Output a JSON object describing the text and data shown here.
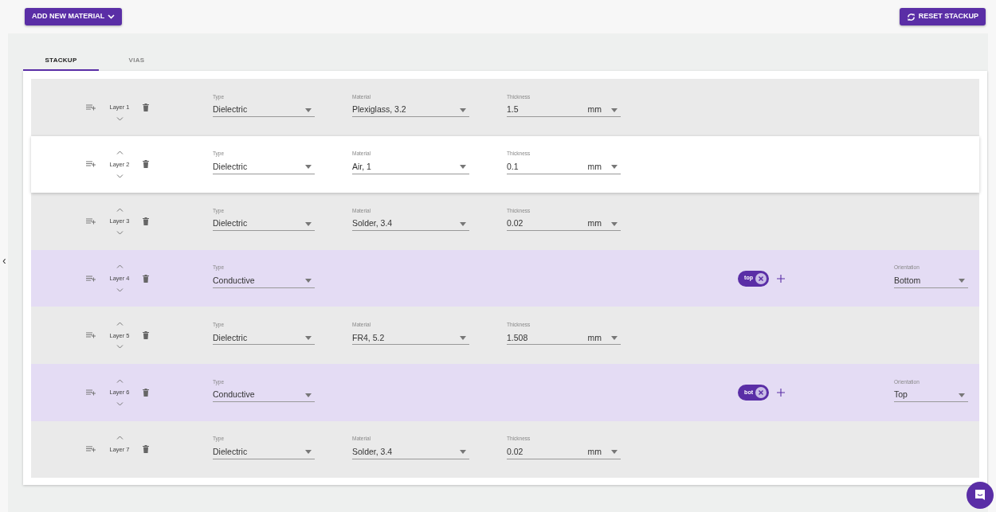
{
  "toolbar": {
    "add_button": "ADD NEW MATERIAL",
    "reset_button": "RESET STACKUP"
  },
  "side_toggle": "‹",
  "tabs": [
    {
      "label": "STACKUP",
      "selected": true
    },
    {
      "label": "VIAS",
      "selected": false
    }
  ],
  "layers": [
    {
      "kind": "dielectric",
      "hovered": false,
      "name": "Layer 1",
      "can_move_up": false,
      "can_move_down": true,
      "type": {
        "label": "Type",
        "value": "Dielectric"
      },
      "material": {
        "label": "Material",
        "value": "Plexiglass, 3.2"
      },
      "thickness": {
        "label": "Thickness",
        "value": "1.5",
        "unit": "mm"
      }
    },
    {
      "kind": "dielectric",
      "hovered": true,
      "name": "Layer 2",
      "can_move_up": true,
      "can_move_down": true,
      "type": {
        "label": "Type",
        "value": "Dielectric"
      },
      "material": {
        "label": "Material",
        "value": "Air, 1"
      },
      "thickness": {
        "label": "Thickness",
        "value": "0.1",
        "unit": "mm"
      }
    },
    {
      "kind": "dielectric",
      "hovered": false,
      "name": "Layer 3",
      "can_move_up": true,
      "can_move_down": true,
      "type": {
        "label": "Type",
        "value": "Dielectric"
      },
      "material": {
        "label": "Material",
        "value": "Solder, 3.4"
      },
      "thickness": {
        "label": "Thickness",
        "value": "0.02",
        "unit": "mm"
      }
    },
    {
      "kind": "conductive",
      "hovered": false,
      "name": "Layer 4",
      "can_move_up": true,
      "can_move_down": true,
      "type": {
        "label": "Type",
        "value": "Conductive"
      },
      "chips": [
        "top"
      ],
      "orientation": {
        "label": "Orientation",
        "value": "Bottom"
      }
    },
    {
      "kind": "dielectric",
      "hovered": false,
      "name": "Layer 5",
      "can_move_up": true,
      "can_move_down": true,
      "type": {
        "label": "Type",
        "value": "Dielectric"
      },
      "material": {
        "label": "Material",
        "value": "FR4, 5.2"
      },
      "thickness": {
        "label": "Thickness",
        "value": "1.508",
        "unit": "mm"
      }
    },
    {
      "kind": "conductive",
      "hovered": false,
      "name": "Layer 6",
      "can_move_up": true,
      "can_move_down": true,
      "type": {
        "label": "Type",
        "value": "Conductive"
      },
      "chips": [
        "bot"
      ],
      "orientation": {
        "label": "Orientation",
        "value": "Top"
      }
    },
    {
      "kind": "dielectric",
      "hovered": false,
      "name": "Layer 7",
      "can_move_up": true,
      "can_move_down": false,
      "type": {
        "label": "Type",
        "value": "Dielectric"
      },
      "material": {
        "label": "Material",
        "value": "Solder, 3.4"
      },
      "thickness": {
        "label": "Thickness",
        "value": "0.02",
        "unit": "mm"
      }
    }
  ]
}
